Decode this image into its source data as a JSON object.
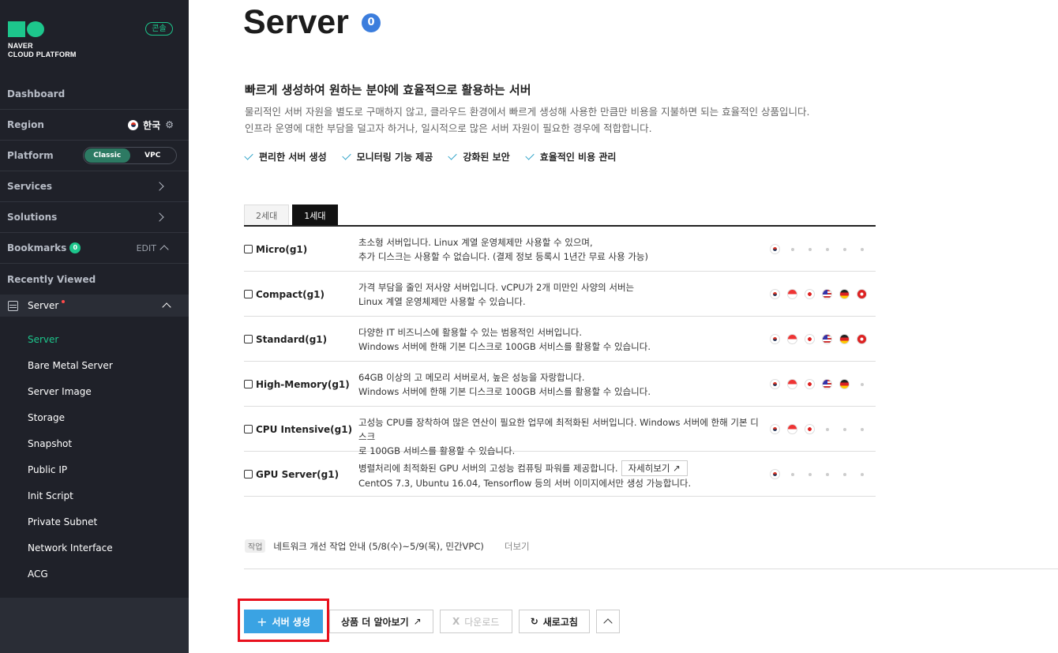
{
  "brand": {
    "line1": "NAVER",
    "line2": "CLOUD PLATFORM",
    "console": "콘솔",
    "accent": "#1dc68c"
  },
  "sidebar": {
    "dashboard": "Dashboard",
    "region": {
      "label": "Region",
      "value": "한국"
    },
    "platform": {
      "label": "Platform",
      "opt1": "Classic",
      "opt2": "VPC",
      "selected": "Classic"
    },
    "services": "Services",
    "solutions": "Solutions",
    "bookmarks": {
      "label": "Bookmarks",
      "count": "0",
      "edit": "EDIT"
    },
    "recent": "Recently Viewed",
    "server_group": "Server",
    "items": [
      "Server",
      "Bare Metal Server",
      "Server Image",
      "Storage",
      "Snapshot",
      "Public IP",
      "Init Script",
      "Private Subnet",
      "Network Interface",
      "ACG"
    ]
  },
  "main": {
    "title": "Server",
    "badge": "0",
    "subhead": "빠르게 생성하여 원하는 분야에 효율적으로 활용하는 서버",
    "desc1": "물리적인 서버 자원을 별도로 구매하지 않고, 클라우드 환경에서 빠르게 생성해 사용한 만큼만 비용을 지불하면 되는 효율적인 상품입니다.",
    "desc2": "인프라 운영에 대한 부담을 덜고자 하거나, 일시적으로 많은 서버 자원이 필요한 경우에 적합합니다.",
    "features": [
      "편리한 서버 생성",
      "모니터링 기능 제공",
      "강화된 보안",
      "효율적인 비용 관리"
    ],
    "tabs": [
      "2세대",
      "1세대"
    ],
    "active_tab": "1세대"
  },
  "products": [
    {
      "name": "Micro(g1)",
      "icon": "server-micro-icon",
      "desc1": "초소형 서버입니다. Linux 계열 운영체제만 사용할 수 있으며,",
      "desc2": "추가 디스크는 사용할 수 없습니다. (결제 정보 등록시 1년간 무료 사용 가능)",
      "regions": [
        "kr",
        "none",
        "none",
        "none",
        "none",
        "none"
      ]
    },
    {
      "name": "Compact(g1)",
      "icon": "server-compact-icon",
      "desc1": "가격 부담을 줄인 저사양 서버입니다. vCPU가 2개 미만인 사양의 서버는",
      "desc2": "Linux 계열 운영체제만 사용할 수 있습니다.",
      "regions": [
        "kr",
        "sg",
        "jp",
        "us",
        "de",
        "hk"
      ]
    },
    {
      "name": "Standard(g1)",
      "icon": "server-standard-icon",
      "desc1": "다양한 IT 비즈니스에 활용할 수 있는 범용적인 서버입니다.",
      "desc2": "Windows 서버에 한해 기본 디스크로 100GB 서비스를 활용할 수 있습니다.",
      "regions": [
        "kr",
        "sg",
        "jp",
        "us",
        "de",
        "hk"
      ]
    },
    {
      "name": "High-Memory(g1)",
      "icon": "server-highmem-icon",
      "desc1": "64GB 이상의 고 메모리 서버로서, 높은 성능을 자랑합니다.",
      "desc2": "Windows 서버에 한해 기본 디스크로 100GB 서비스를 활용할 수 있습니다.",
      "regions": [
        "kr",
        "sg",
        "jp",
        "us",
        "de",
        "none"
      ]
    },
    {
      "name": "CPU Intensive(g1)",
      "icon": "server-cpu-icon",
      "desc1": "고성능 CPU를 장착하여 많은 연산이 필요한 업무에 최적화된 서버입니다. Windows 서버에 한해 기본 디스크",
      "desc2": "로 100GB 서비스를 활용할 수 있습니다.",
      "regions": [
        "kr",
        "sg",
        "jp",
        "none",
        "none",
        "none"
      ]
    },
    {
      "name": "GPU Server(g1)",
      "icon": "server-gpu-icon",
      "desc1": "병렬처리에 최적화된 GPU 서버의 고성능 컴퓨팅 파워를 제공합니다.",
      "more": "자세히보기 ↗",
      "desc2": "CentOS 7.3, Ubuntu 16.04, Tensorflow 등의 서버 이미지에서만 생성 가능합니다.",
      "regions": [
        "kr",
        "none",
        "none",
        "none",
        "none",
        "none"
      ]
    }
  ],
  "notice": {
    "tag": "작업",
    "text": "네트워크 개선 작업 안내 (5/8(수)~5/9(목), 민간VPC)",
    "more": "더보기"
  },
  "actions": {
    "create": "서버 생성",
    "learn": "상품 더 알아보기",
    "download": "다운로드",
    "refresh": "새로고침"
  }
}
